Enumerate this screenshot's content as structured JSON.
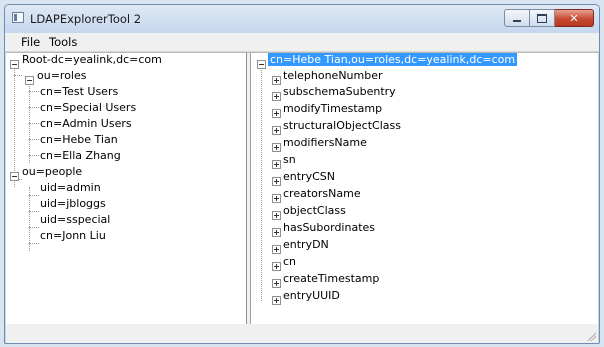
{
  "window": {
    "title": "LDAPExplorerTool 2"
  },
  "menu": {
    "file": "File",
    "tools": "Tools"
  },
  "left_tree": {
    "root": "Root-dc=yealink,dc=com",
    "roles": {
      "label": "ou=roles",
      "children": [
        "cn=Test Users",
        "cn=Special Users",
        "cn=Admin Users",
        "cn=Hebe Tian",
        "cn=Ella Zhang"
      ]
    },
    "people": {
      "label": "ou=people",
      "children": [
        "uid=admin",
        "uid=jbloggs",
        "uid=sspecial",
        "cn=Jonn Liu"
      ]
    }
  },
  "right_tree": {
    "root": "cn=Hebe Tian,ou=roles,dc=yealink,dc=com",
    "attributes": [
      "telephoneNumber",
      "subschemaSubentry",
      "modifyTimestamp",
      "structuralObjectClass",
      "modifiersName",
      "sn",
      "entryCSN",
      "creatorsName",
      "objectClass",
      "hasSubordinates",
      "entryDN",
      "cn",
      "createTimestamp",
      "entryUUID"
    ]
  },
  "colors": {
    "selection": "#3399ff",
    "close_button": "#c74a31",
    "frame": "#c4d5ec"
  }
}
